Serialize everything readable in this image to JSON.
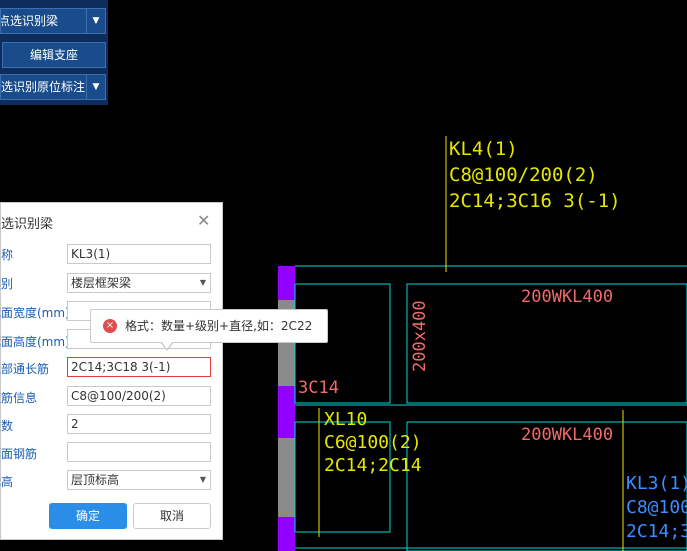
{
  "toolbar": {
    "item1": "点选识别梁",
    "item2": "编辑支座",
    "item3": "点选识别原位标注"
  },
  "dialog": {
    "title": "点选识别梁",
    "close": "✕",
    "labels": [
      "名称",
      "类别",
      "截面宽度(mm)",
      "截面高度(mm)",
      "上部通长筋",
      "箍筋信息",
      "肢数",
      "侧面钢筋",
      "标高"
    ],
    "name_value": "KL3(1)",
    "category_value": "楼层框架梁",
    "width_value": "",
    "height_value": "",
    "top_rebar_value": "2C14;3C18 3(-1)",
    "stirrup_value": "C8@100/200(2)",
    "legs_value": "2",
    "side_rebar_value": "",
    "elevation_value": "层顶标高",
    "ok": "确定",
    "cancel": "取消"
  },
  "tooltip": {
    "icon": "×",
    "text": "格式：数量+级别+直径,如：2C22"
  },
  "cad": {
    "kl4": [
      "KL4(1)",
      "C8@100/200(2)",
      "2C14;3C16 3(-1)"
    ],
    "wkl_top": "200WKL400",
    "wkl_mid": "200WKL400",
    "size_vertical": "200x400",
    "left_rebar": "3C14",
    "xl10": [
      "XL10",
      "C6@100(2)",
      "2C14;2C14"
    ],
    "kl3": [
      "KL3(1)",
      "C8@100/",
      "2C14;3C"
    ]
  },
  "colors": {
    "cyan": "#00d8d8",
    "yellow": "#e6e600",
    "magenta": "#8a00e6",
    "salmon": "#f06a6a",
    "blue_text": "#3a8cff"
  }
}
